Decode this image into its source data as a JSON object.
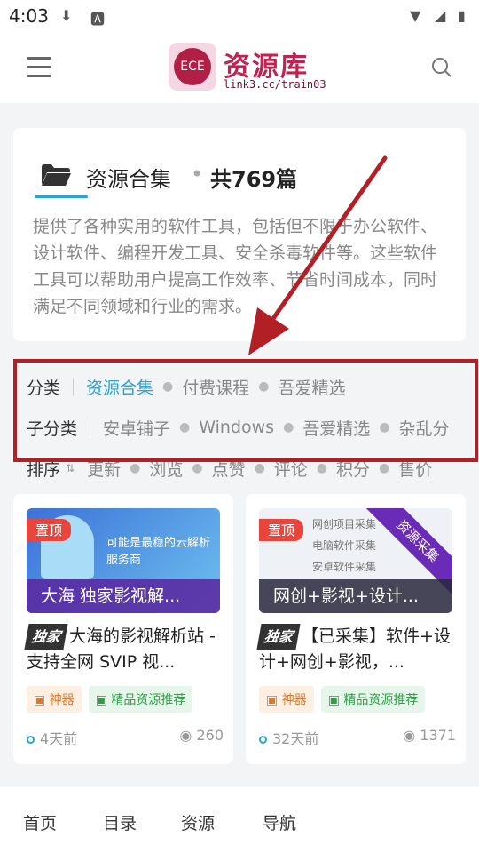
{
  "status_bar": {
    "time": "4:03",
    "icons": [
      "download-icon",
      "a-icon",
      "wifi-icon",
      "signal-icon",
      "battery-icon"
    ]
  },
  "header": {
    "logo_title": "资源库",
    "logo_subtitle": "link3.cc/train03",
    "logo_badge": "ECE"
  },
  "info_card": {
    "title": "资源合集",
    "separator": "•",
    "count": "共769篇",
    "description": "提供了各种实用的软件工具，包括但不限于办公软件、设计软件、编程开发工具、安全杀毒软件等。这些软件工具可以帮助用户提高工作效率、节省时间成本，同时满足不同领域和行业的需求。"
  },
  "filter": {
    "category_label": "分类",
    "categories": [
      {
        "label": "资源合集",
        "active": true
      },
      {
        "label": "付费课程",
        "active": false
      },
      {
        "label": "吾爱精选",
        "active": false
      }
    ],
    "sub_label": "子分类",
    "subcategories": [
      "安卓铺子",
      "Windows",
      "吾爱精选",
      "杂乱分"
    ],
    "sort_label": "排序",
    "sort_options": [
      "更新",
      "浏览",
      "点赞",
      "评论",
      "积分",
      "售价"
    ]
  },
  "articles": [
    {
      "pin": "置顶",
      "thumb_caption": "大海 独家影视解...",
      "thumb_text": "可能是最稳的云解析服务商",
      "exclusive": "独家",
      "title": "大海的影视解析站 - 支持全网 SVIP 视...",
      "tags": [
        "神器",
        "精品资源推荐"
      ],
      "time": "4天前",
      "views": "260"
    },
    {
      "pin": "置顶",
      "thumb_caption": "网创+影视+设计...",
      "ribbon": "资源采集",
      "thumb_list": [
        "网创项目采集",
        "电脑软件采集",
        "安卓软件采集"
      ],
      "exclusive": "独家",
      "title": "【已采集】软件+设计+网创+影视，...",
      "tags": [
        "神器",
        "精品资源推荐"
      ],
      "time": "32天前",
      "views": "1371"
    }
  ],
  "bottom_nav": [
    "首页",
    "目录",
    "资源",
    "导航"
  ],
  "colors": {
    "brand": "#c2224f",
    "accent": "#2aa3d6",
    "highlight": "#b21f25"
  }
}
